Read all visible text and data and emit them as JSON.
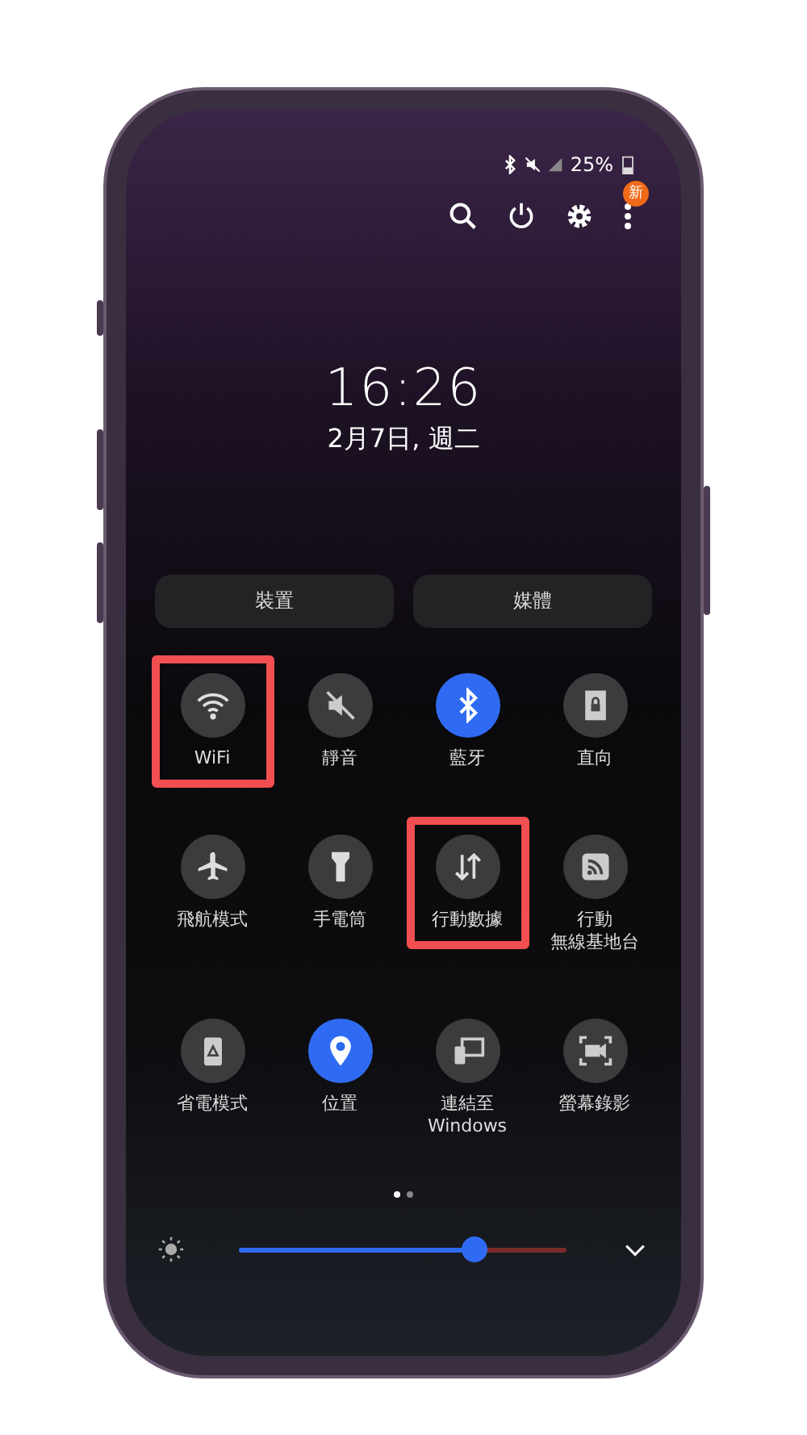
{
  "status_bar": {
    "battery": "25%"
  },
  "header": {
    "badge": "新"
  },
  "lock": {
    "time": "16:26",
    "date": "2月7日, 週二"
  },
  "buttons": [
    {
      "label": "裝置"
    },
    {
      "label": "媒體"
    }
  ],
  "tiles": [
    {
      "label": "WiFi",
      "on": false,
      "highlighted": true
    },
    {
      "label": "靜音",
      "on": false,
      "highlighted": false
    },
    {
      "label": "藍牙",
      "on": true,
      "highlighted": false
    },
    {
      "label": "直向",
      "on": false,
      "highlighted": false
    },
    {
      "label": "飛航模式",
      "on": false,
      "highlighted": false
    },
    {
      "label": "手電筒",
      "on": false,
      "highlighted": false
    },
    {
      "label": "行動數據",
      "on": false,
      "highlighted": true
    },
    {
      "lines": [
        "行動",
        "無線基地台"
      ],
      "on": false,
      "highlighted": false
    },
    {
      "label": "省電模式",
      "on": false,
      "highlighted": false
    },
    {
      "label": "位置",
      "on": true,
      "highlighted": false
    },
    {
      "lines": [
        "連結至",
        "Windows"
      ],
      "on": false,
      "highlighted": false
    },
    {
      "label": "螢幕錄影",
      "on": false,
      "highlighted": false
    }
  ],
  "pager": [
    {
      "selected": true
    },
    {
      "selected": false
    }
  ],
  "brightness": {
    "level": 0.72
  }
}
